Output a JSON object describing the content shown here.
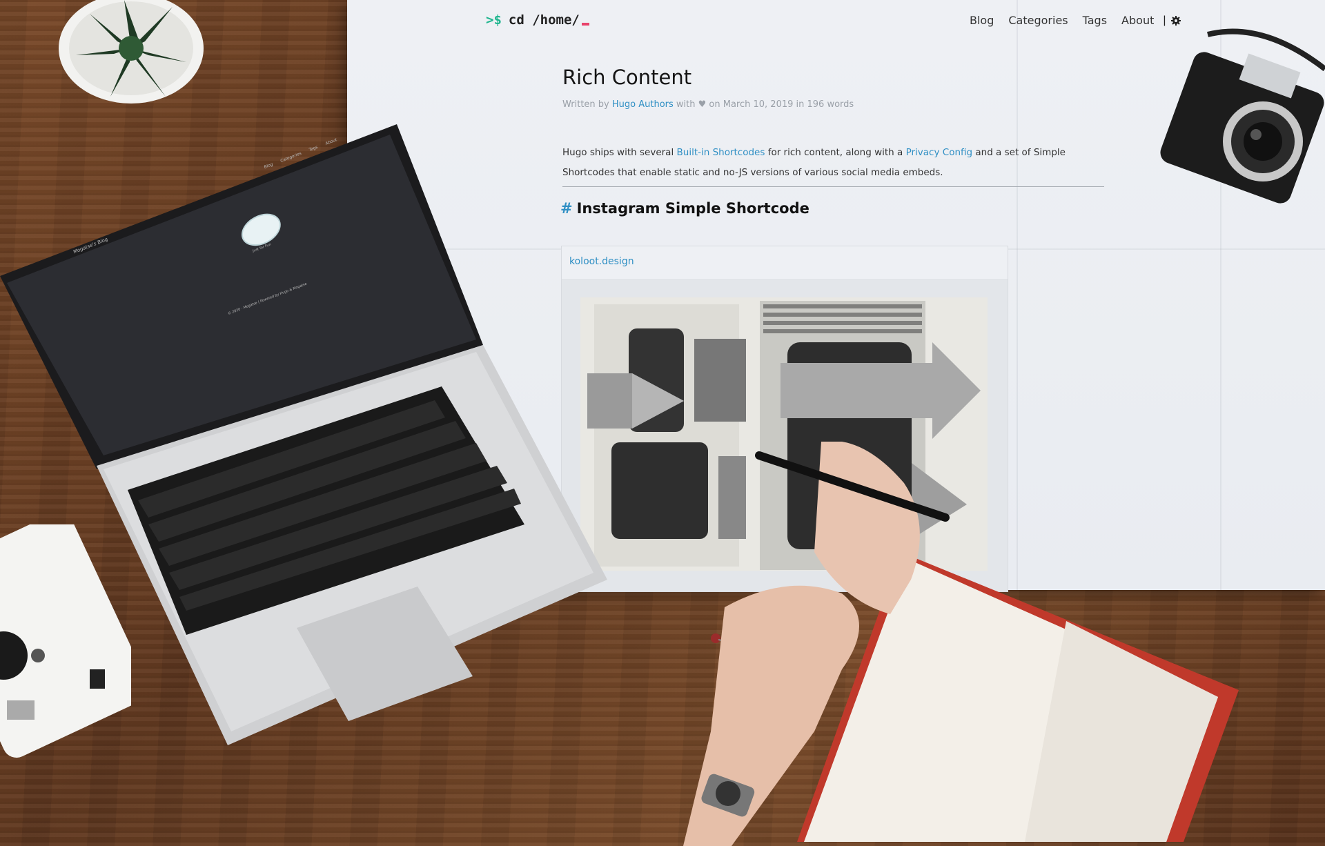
{
  "site": {
    "brand_prompt": ">$",
    "brand_path": "cd /home/",
    "nav": [
      "Blog",
      "Categories",
      "Tags",
      "About"
    ],
    "nav_separator": "|"
  },
  "article": {
    "title": "Rich Content",
    "meta_prefix": "Written by ",
    "meta_author": "Hugo Authors",
    "meta_suffix": " with ♥ on March 10, 2019 in 196 words",
    "body_1": "Hugo ships with several ",
    "body_link_1": "Built-in Shortcodes",
    "body_2": " for rich content, along with a ",
    "body_link_2": "Privacy Config",
    "body_3": " and a set of Simple Shortcodes that enable static and no-JS versions of various social media embeds.",
    "heading_hash": "#",
    "heading": "Instagram Simple Shortcode"
  },
  "embed": {
    "username": "koloot.design"
  },
  "laptop_screen": {
    "blog_title": "Mogatse's Blog",
    "nav": [
      "Blog",
      "Categories",
      "Tags",
      "About"
    ],
    "tagline": "Just for Fun",
    "footer": "© 2020 · Mogatse | Powered by Hugo & Mogatse"
  },
  "colors": {
    "accent": "#2f8fc4",
    "prompt": "#1fb58e",
    "cursor": "#e8436b",
    "paper": "#eef0f4"
  }
}
